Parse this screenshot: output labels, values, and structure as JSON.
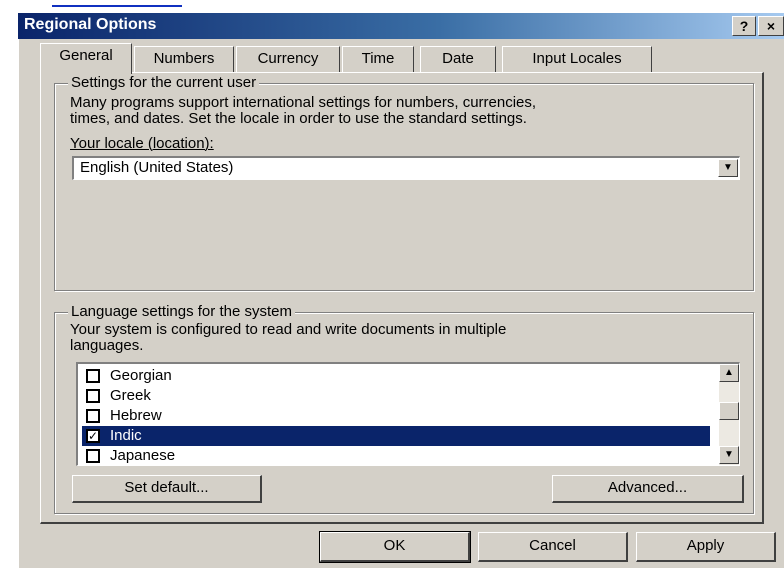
{
  "window": {
    "title": "Regional Options",
    "help_button": "?",
    "close_button": "×"
  },
  "tabs": [
    {
      "label": "General"
    },
    {
      "label": "Numbers"
    },
    {
      "label": "Currency"
    },
    {
      "label": "Time"
    },
    {
      "label": "Date"
    },
    {
      "label": "Input Locales"
    }
  ],
  "user_settings": {
    "group_label": "Settings for the current user",
    "description_line1": "Many programs support international settings for numbers, currencies,",
    "description_line2": "times, and dates. Set the locale in order to use the standard settings.",
    "locale_label": "Your locale (location):",
    "locale_value": "English (United States)"
  },
  "language_settings": {
    "group_label": "Language settings for the system",
    "description_line1": "Your system is configured to read and write documents in multiple",
    "description_line2": "languages.",
    "languages": [
      {
        "label": "Georgian",
        "checked": false,
        "selected": false
      },
      {
        "label": "Greek",
        "checked": false,
        "selected": false
      },
      {
        "label": "Hebrew",
        "checked": false,
        "selected": false
      },
      {
        "label": "Indic",
        "checked": true,
        "selected": true
      },
      {
        "label": "Japanese",
        "checked": false,
        "selected": false
      }
    ],
    "set_default_button": "Set default...",
    "advanced_button": "Advanced..."
  },
  "footer": {
    "ok_button": "OK",
    "cancel_button": "Cancel",
    "apply_button": "Apply"
  },
  "colors": {
    "title_bar": "#0a246a",
    "selection": "#0a246a",
    "dialog_face": "#d4d0c8"
  },
  "icons": {
    "combo_arrow": "chevron-down-icon",
    "scroll_up": "scroll-up-arrow-icon",
    "scroll_down": "scroll-down-arrow-icon",
    "checkmark": "checkmark-icon"
  }
}
